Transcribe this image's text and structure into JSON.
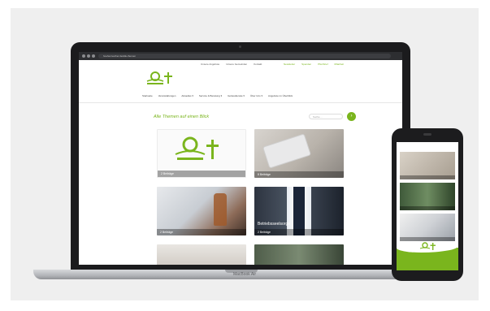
{
  "browser": {
    "url": "hoehenreuther.de/alle-themen"
  },
  "header": {
    "top_links": [
      "Unsere Angebote",
      "Unsere Gemeinden",
      "Kontakt"
    ],
    "top_links_right": [
      "Newsletter",
      "Spenden",
      "Pfarrbrief",
      "Mitarbeit"
    ],
    "nav_items": [
      "Startseite",
      "Veranstaltungen",
      "Aktuelles ▾",
      "Service & Beratung ▾",
      "Gottesdienste ▾",
      "Über Uns ▾",
      "Angebote im Überblick"
    ]
  },
  "main": {
    "title": "Alle Themen auf einen Blick",
    "search_placeholder": "Suche ...",
    "cards": [
      {
        "label": "2 Beiträge"
      },
      {
        "label": "8 Beiträge"
      },
      {
        "label": "2 Beiträge"
      },
      {
        "label": "2 Beiträge"
      }
    ],
    "card_titles": [
      "",
      "",
      "",
      "Betriebsseelsorge"
    ]
  },
  "laptop": {
    "model": "MacBook Air"
  },
  "colors": {
    "brand_green": "#7ab51d"
  }
}
